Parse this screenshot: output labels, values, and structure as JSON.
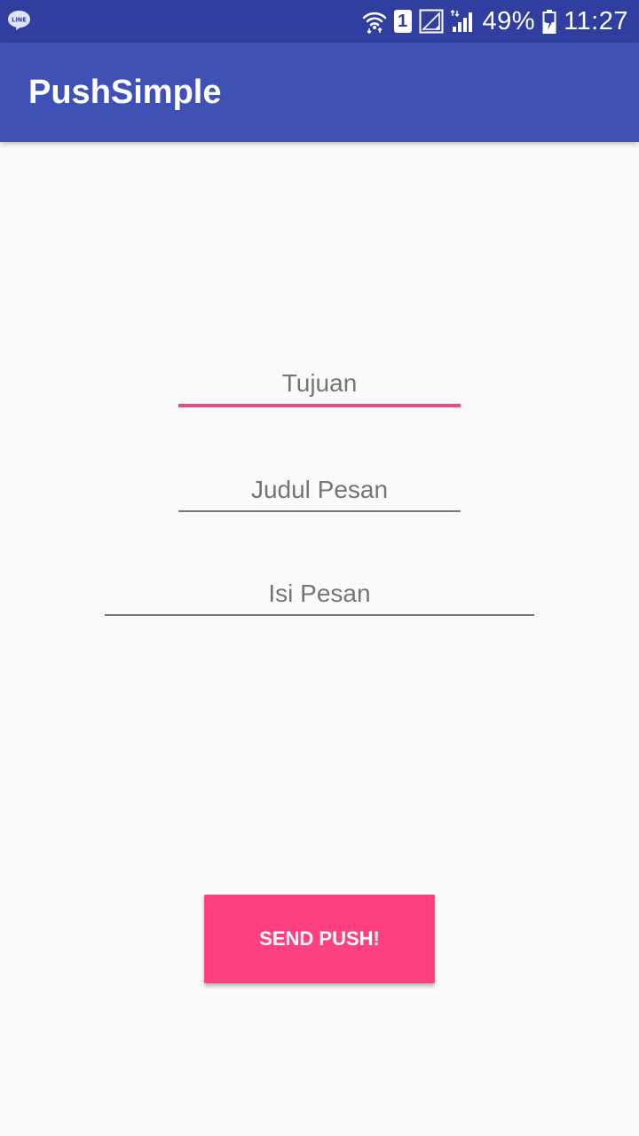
{
  "status_bar": {
    "notification_icon": "line-app-icon",
    "notification_icon_text": "LINE",
    "icons": [
      "wifi-icon",
      "sim-1-icon",
      "no-signal-icon",
      "cell-signal-icon",
      "battery-charging-icon"
    ],
    "sim_label": "1",
    "battery_percent": "49%",
    "time": "11:27",
    "color": "#303f9f"
  },
  "app_bar": {
    "title": "PushSimple",
    "color": "#3f51b5"
  },
  "form": {
    "fields": [
      {
        "id": "tujuan",
        "placeholder": "Tujuan",
        "value": "",
        "focused": true
      },
      {
        "id": "judul_pesan",
        "placeholder": "Judul Pesan",
        "value": "",
        "focused": false
      },
      {
        "id": "isi_pesan",
        "placeholder": "Isi Pesan",
        "value": "",
        "focused": false
      }
    ],
    "focus_color": "#ee4a7e"
  },
  "actions": {
    "send_label": "SEND PUSH!",
    "accent_color": "#ff4081"
  }
}
